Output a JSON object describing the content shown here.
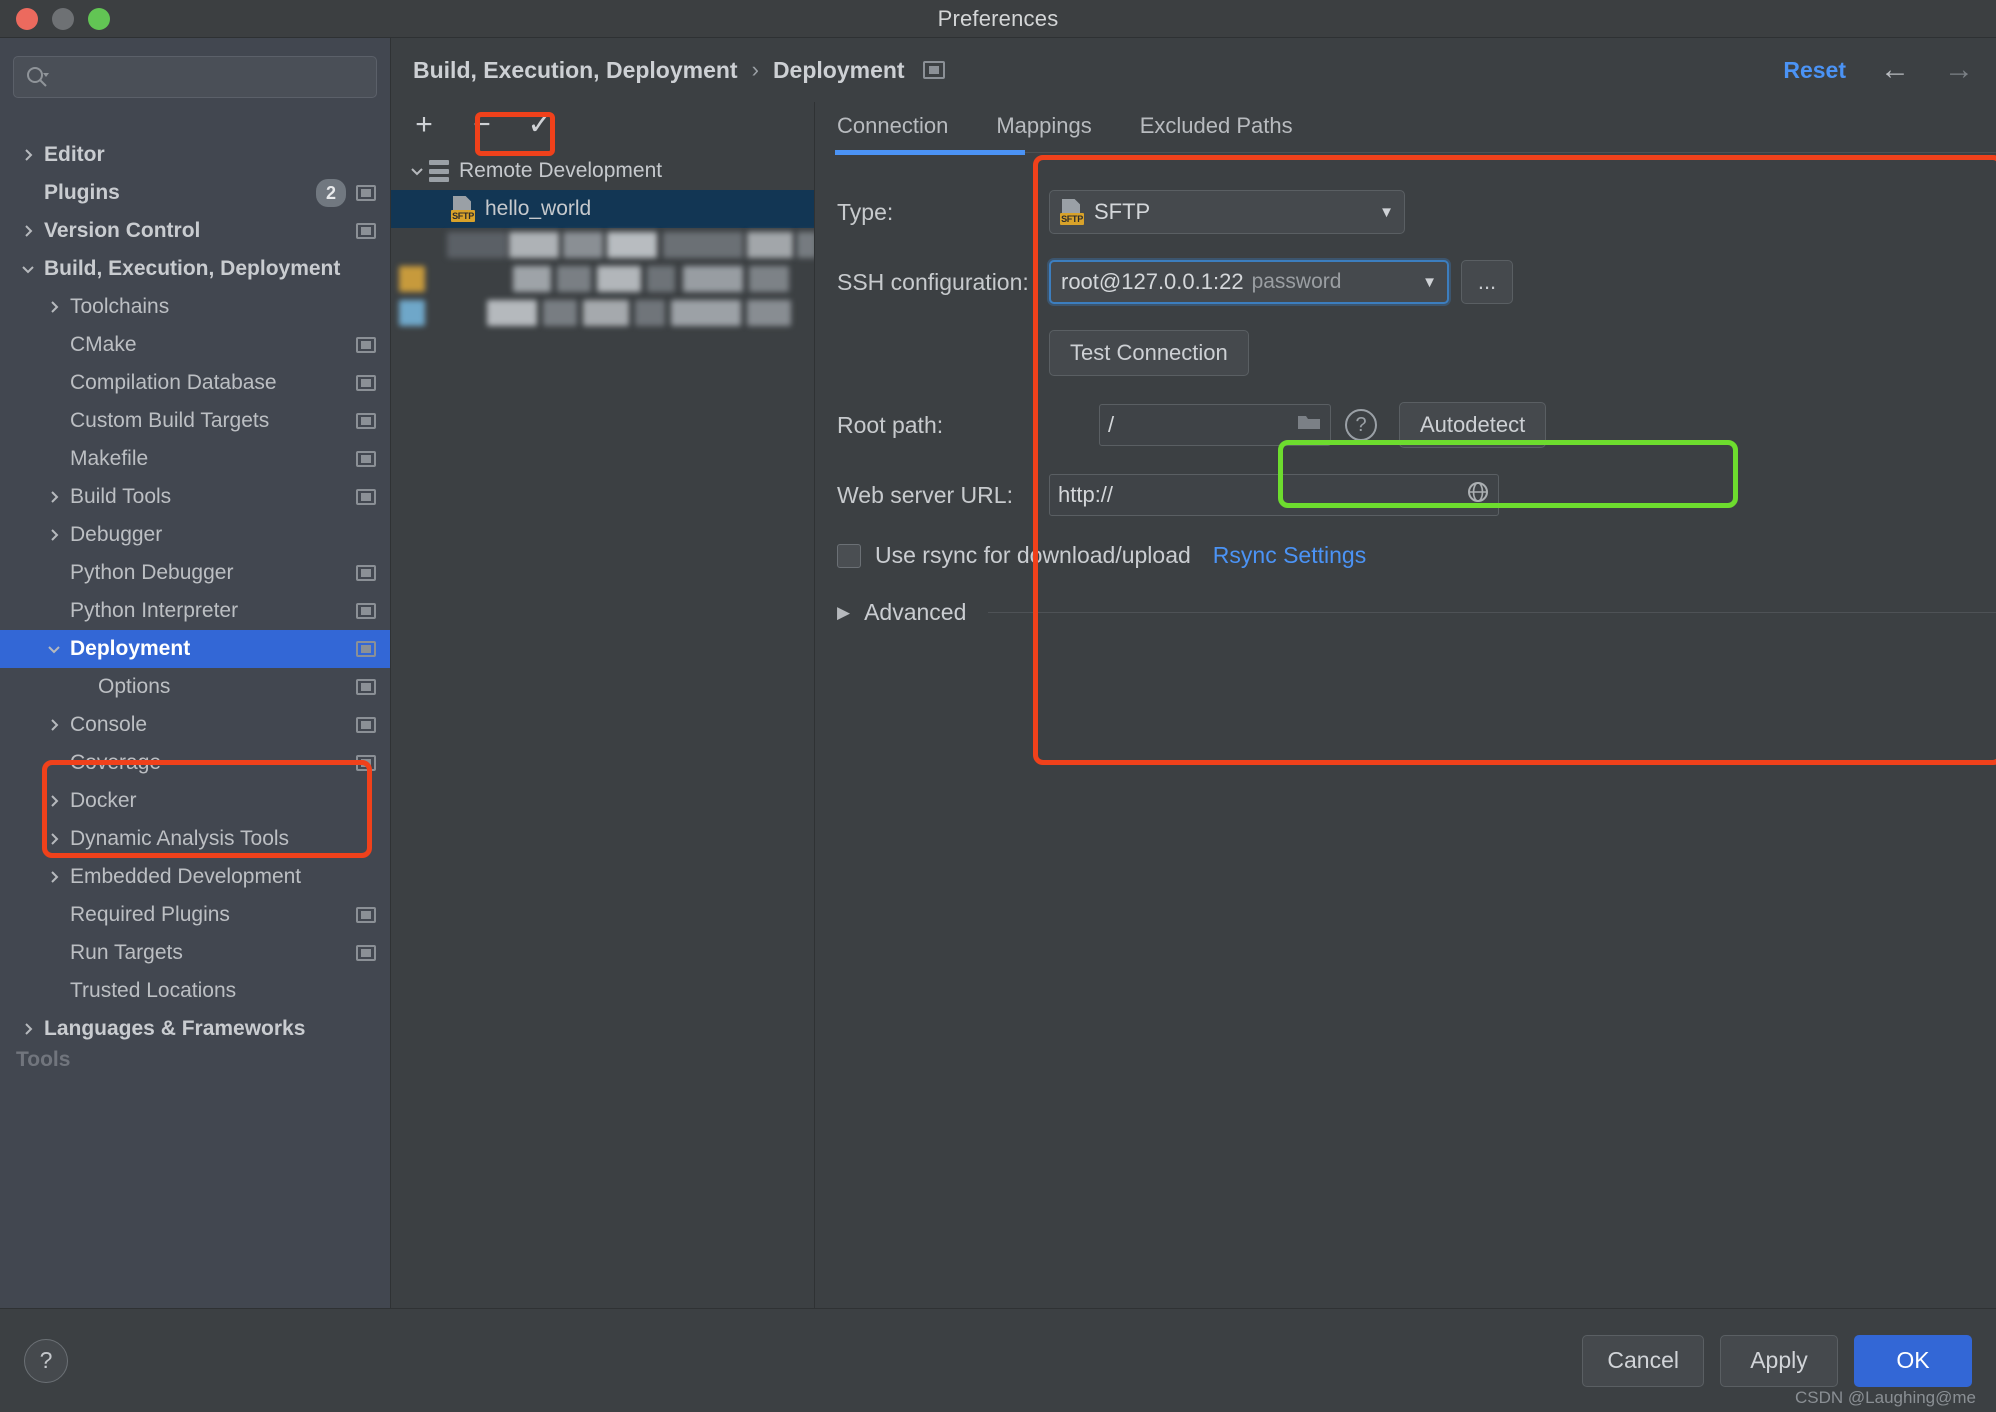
{
  "window": {
    "title": "Preferences"
  },
  "search": {
    "placeholder": "",
    "icon": "search-icon"
  },
  "sidebar": {
    "items": [
      {
        "label": "Editor",
        "arrow": "right",
        "indent": 0,
        "bold": true,
        "badge": null,
        "mini": false,
        "selected": false
      },
      {
        "label": "Plugins",
        "arrow": "none",
        "indent": 0,
        "bold": true,
        "badge": "2",
        "mini": true,
        "selected": false
      },
      {
        "label": "Version Control",
        "arrow": "right",
        "indent": 0,
        "bold": true,
        "badge": null,
        "mini": true,
        "selected": false
      },
      {
        "label": "Build, Execution, Deployment",
        "arrow": "down",
        "indent": 0,
        "bold": true,
        "badge": null,
        "mini": false,
        "selected": false
      },
      {
        "label": "Toolchains",
        "arrow": "right",
        "indent": 1,
        "bold": false,
        "badge": null,
        "mini": false,
        "selected": false
      },
      {
        "label": "CMake",
        "arrow": "none",
        "indent": 1,
        "bold": false,
        "badge": null,
        "mini": true,
        "selected": false
      },
      {
        "label": "Compilation Database",
        "arrow": "none",
        "indent": 1,
        "bold": false,
        "badge": null,
        "mini": true,
        "selected": false
      },
      {
        "label": "Custom Build Targets",
        "arrow": "none",
        "indent": 1,
        "bold": false,
        "badge": null,
        "mini": true,
        "selected": false
      },
      {
        "label": "Makefile",
        "arrow": "none",
        "indent": 1,
        "bold": false,
        "badge": null,
        "mini": true,
        "selected": false
      },
      {
        "label": "Build Tools",
        "arrow": "right",
        "indent": 1,
        "bold": false,
        "badge": null,
        "mini": true,
        "selected": false
      },
      {
        "label": "Debugger",
        "arrow": "right",
        "indent": 1,
        "bold": false,
        "badge": null,
        "mini": false,
        "selected": false
      },
      {
        "label": "Python Debugger",
        "arrow": "none",
        "indent": 1,
        "bold": false,
        "badge": null,
        "mini": true,
        "selected": false
      },
      {
        "label": "Python Interpreter",
        "arrow": "none",
        "indent": 1,
        "bold": false,
        "badge": null,
        "mini": true,
        "selected": false
      },
      {
        "label": "Deployment",
        "arrow": "down",
        "indent": 1,
        "bold": true,
        "badge": null,
        "mini": true,
        "selected": true
      },
      {
        "label": "Options",
        "arrow": "none",
        "indent": 2,
        "bold": false,
        "badge": null,
        "mini": true,
        "selected": false
      },
      {
        "label": "Console",
        "arrow": "right",
        "indent": 1,
        "bold": false,
        "badge": null,
        "mini": true,
        "selected": false
      },
      {
        "label": "Coverage",
        "arrow": "none",
        "indent": 1,
        "bold": false,
        "badge": null,
        "mini": true,
        "selected": false
      },
      {
        "label": "Docker",
        "arrow": "right",
        "indent": 1,
        "bold": false,
        "badge": null,
        "mini": false,
        "selected": false
      },
      {
        "label": "Dynamic Analysis Tools",
        "arrow": "right",
        "indent": 1,
        "bold": false,
        "badge": null,
        "mini": false,
        "selected": false
      },
      {
        "label": "Embedded Development",
        "arrow": "right",
        "indent": 1,
        "bold": false,
        "badge": null,
        "mini": false,
        "selected": false
      },
      {
        "label": "Required Plugins",
        "arrow": "none",
        "indent": 1,
        "bold": false,
        "badge": null,
        "mini": true,
        "selected": false
      },
      {
        "label": "Run Targets",
        "arrow": "none",
        "indent": 1,
        "bold": false,
        "badge": null,
        "mini": true,
        "selected": false
      },
      {
        "label": "Trusted Locations",
        "arrow": "none",
        "indent": 1,
        "bold": false,
        "badge": null,
        "mini": false,
        "selected": false
      },
      {
        "label": "Languages & Frameworks",
        "arrow": "right",
        "indent": 0,
        "bold": true,
        "badge": null,
        "mini": false,
        "selected": false
      }
    ],
    "clipped_bottom_label": "Tools"
  },
  "breadcrumb": {
    "root": "Build, Execution, Deployment",
    "separator": "›",
    "current": "Deployment",
    "reset_label": "Reset",
    "back_arrow": "←",
    "forward_arrow": "→"
  },
  "mid_toolbar": {
    "add_label": "+",
    "remove_label": "−",
    "default_label": "✓"
  },
  "server_tree": {
    "root_label": "Remote Development",
    "selected_server": "hello_world",
    "selected_server_type": "SFTP"
  },
  "tabs": {
    "items": [
      "Connection",
      "Mappings",
      "Excluded Paths"
    ],
    "active": "Connection"
  },
  "form": {
    "type_label": "Type:",
    "type_value": "SFTP",
    "type_badge": "SFTP",
    "ssh_label": "SSH configuration:",
    "ssh_value": "root@127.0.0.1:22",
    "ssh_auth": "password",
    "ssh_more_label": "...",
    "test_connection_label": "Test Connection",
    "root_path_label": "Root path:",
    "root_path_value": "/",
    "root_path_browse_icon": "folder-icon",
    "root_path_help_icon": "question-mark-icon",
    "autodetect_label": "Autodetect",
    "web_url_label": "Web server URL:",
    "web_url_value": "http://",
    "web_url_icon": "globe-icon",
    "rsync_checkbox_label": "Use rsync for download/upload",
    "rsync_checked": false,
    "rsync_settings_link": "Rsync Settings",
    "advanced_label": "Advanced"
  },
  "footer": {
    "help_label": "?",
    "cancel_label": "Cancel",
    "apply_label": "Apply",
    "ok_label": "OK",
    "watermark": "CSDN @Laughing@me"
  },
  "colors": {
    "accent_blue": "#3367d6",
    "link_blue": "#4b93f5",
    "annotation_red": "#f0411b",
    "annotation_green": "#6ddc2e",
    "selection_row": "#123654",
    "sftp_badge": "#d8a22a"
  }
}
